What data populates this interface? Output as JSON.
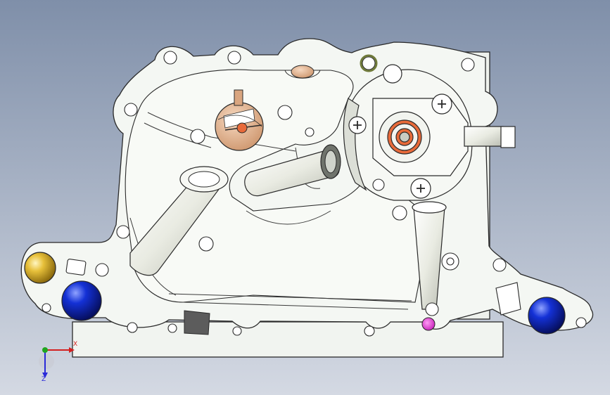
{
  "viewport": {
    "background_top": "#7f8fa9",
    "background_bottom": "#d4d9e3"
  },
  "part": {
    "body_fill": "#f4f7f3",
    "edge_color": "#2a2a2a",
    "hole_fill": "#ffffff",
    "bronze_color": "#d9a57f",
    "gold_color": "#c59a12",
    "blue_color": "#0b1fa8",
    "magenta_color": "#e02fd2",
    "orange_color": "#e86a3a",
    "gasket_color": "#5c5c5c"
  },
  "triad": {
    "x_label": "X",
    "z_label": "Z",
    "x_color": "#d32020",
    "y_color": "#1fa51f",
    "z_color": "#2a2ad8"
  }
}
